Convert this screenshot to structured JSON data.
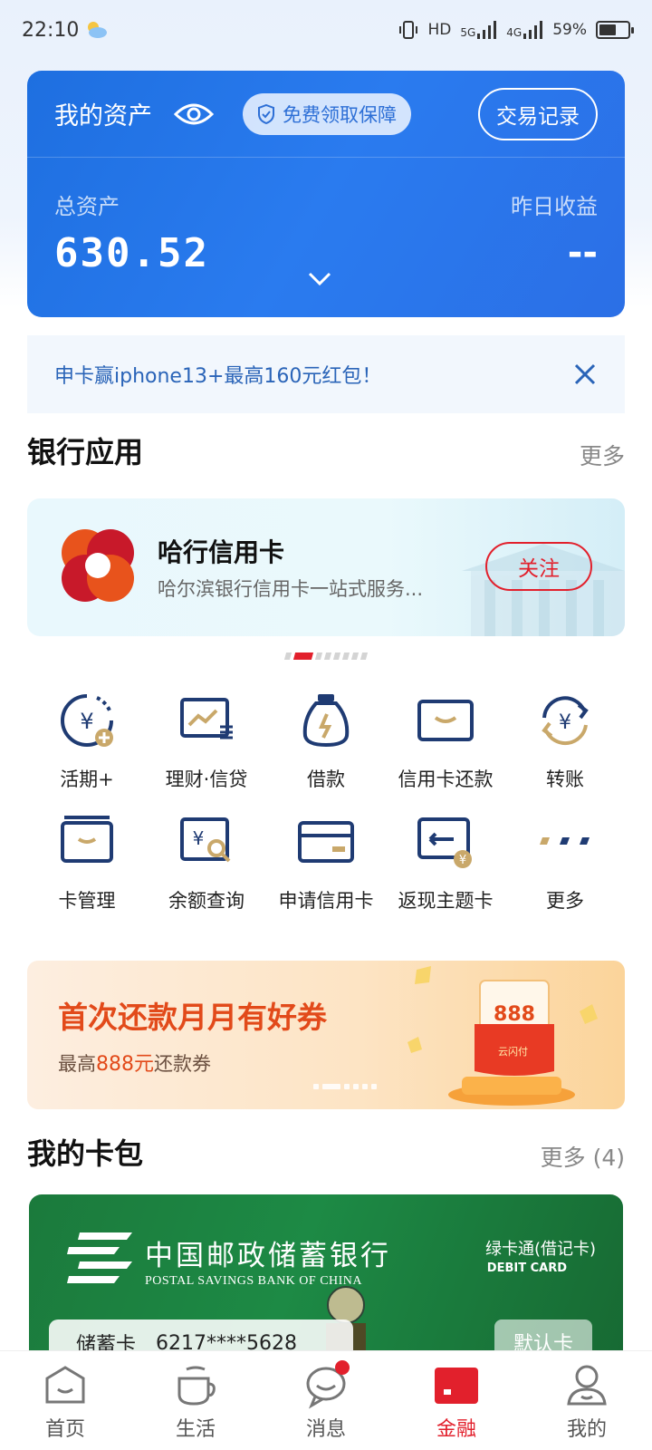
{
  "status_bar": {
    "time": "22:10",
    "network_hd": "HD",
    "network_5g": "5G",
    "network_4g": "4G",
    "battery": "59%"
  },
  "assets": {
    "title": "我的资产",
    "guarantee_label": "免费领取保障",
    "transactions_button": "交易记录",
    "total_label": "总资产",
    "total_value": "630.52",
    "yesterday_label": "昨日收益",
    "yesterday_value": "--"
  },
  "promo_banner": {
    "text": "申卡赢iphone13+最高160元红包！"
  },
  "bank_apps": {
    "title": "银行应用",
    "more": "更多",
    "card": {
      "name": "哈行信用卡",
      "description": "哈尔滨银行信用卡一站式服务...",
      "follow_label": "关注"
    }
  },
  "grid": {
    "row1": [
      {
        "label": "活期+",
        "icon": "current-deposit-icon"
      },
      {
        "label": "理财·信贷",
        "icon": "wealth-loan-icon"
      },
      {
        "label": "借款",
        "icon": "loan-bag-icon"
      },
      {
        "label": "信用卡还款",
        "icon": "credit-card-repay-icon"
      },
      {
        "label": "转账",
        "icon": "transfer-icon"
      }
    ],
    "row2": [
      {
        "label": "卡管理",
        "icon": "card-manage-icon"
      },
      {
        "label": "余额查询",
        "icon": "balance-query-icon"
      },
      {
        "label": "申请信用卡",
        "icon": "apply-card-icon"
      },
      {
        "label": "返现主题卡",
        "icon": "cashback-card-icon"
      },
      {
        "label": "更多",
        "icon": "more-dots-icon"
      }
    ]
  },
  "coupon_banner": {
    "title": "首次还款月月有好券",
    "sub_prefix": "最高",
    "sub_highlight": "888元",
    "sub_suffix": "还款券",
    "art_amount": "888",
    "art_label": "云闪付"
  },
  "wallet": {
    "title": "我的卡包",
    "more": "更多 (4)",
    "card": {
      "bank_name_cn": "中国邮政储蓄银行",
      "bank_name_en": "POSTAL SAVINGS BANK OF CHINA",
      "card_product": "绿卡通(借记卡)",
      "card_product_en": "DEBIT CARD",
      "card_kind": "储蓄卡",
      "card_number": "6217****5628",
      "default_tag": "默认卡"
    }
  },
  "tab_bar": [
    {
      "label": "首页",
      "icon": "home-icon"
    },
    {
      "label": "生活",
      "icon": "cup-icon"
    },
    {
      "label": "消息",
      "icon": "message-icon"
    },
    {
      "label": "金融",
      "icon": "finance-icon"
    },
    {
      "label": "我的",
      "icon": "profile-icon"
    }
  ],
  "colors": {
    "brand_red": "#e2202c",
    "asset_blue": "#2a7bef",
    "icon_navy": "#1f3b73",
    "icon_gold": "#c9a86a",
    "bank_green": "#1d8a45"
  }
}
